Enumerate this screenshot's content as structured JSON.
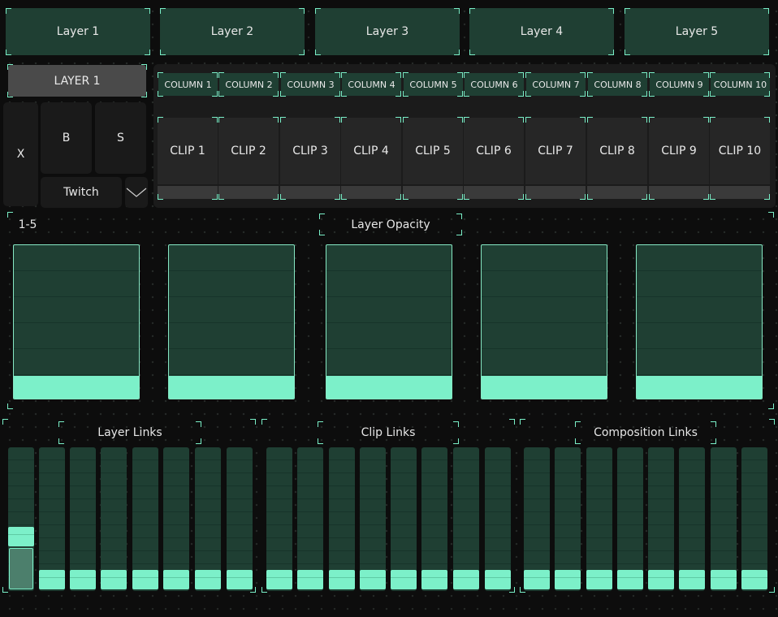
{
  "layers": [
    "Layer 1",
    "Layer 2",
    "Layer 3",
    "Layer 4",
    "Layer 5"
  ],
  "selected_layer": "LAYER 1",
  "buttons": {
    "x": "X",
    "b": "B",
    "s": "S",
    "twitch": "Twitch",
    "dropdown_icon": "chevron-down-icon"
  },
  "columns": [
    "COLUMN 1",
    "COLUMN 2",
    "COLUMN 3",
    "COLUMN 4",
    "COLUMN 5",
    "COLUMN 6",
    "COLUMN 7",
    "COLUMN 8",
    "COLUMN 9",
    "COLUMN 10"
  ],
  "clips": [
    "CLIP 1",
    "CLIP 2",
    "CLIP 3",
    "CLIP 4",
    "CLIP 5",
    "CLIP 6",
    "CLIP 7",
    "CLIP 8",
    "CLIP 9",
    "CLIP 10"
  ],
  "opacity_section": {
    "range_label": "1-5",
    "title": "Layer Opacity",
    "levels": [
      0.15,
      0.15,
      0.15,
      0.15,
      0.15
    ]
  },
  "links": [
    {
      "title": "Layer Links",
      "levels": [
        0.35,
        0,
        0,
        0,
        0,
        0,
        0,
        0
      ]
    },
    {
      "title": "Clip Links",
      "levels": [
        0,
        0,
        0,
        0,
        0,
        0,
        0,
        0
      ]
    },
    {
      "title": "Composition Links",
      "levels": [
        0,
        0,
        0,
        0,
        0,
        0,
        0,
        0
      ]
    }
  ],
  "colors": {
    "accent": "#7cf0c9",
    "button": "#1f3f33",
    "background": "#0d0d0d"
  }
}
